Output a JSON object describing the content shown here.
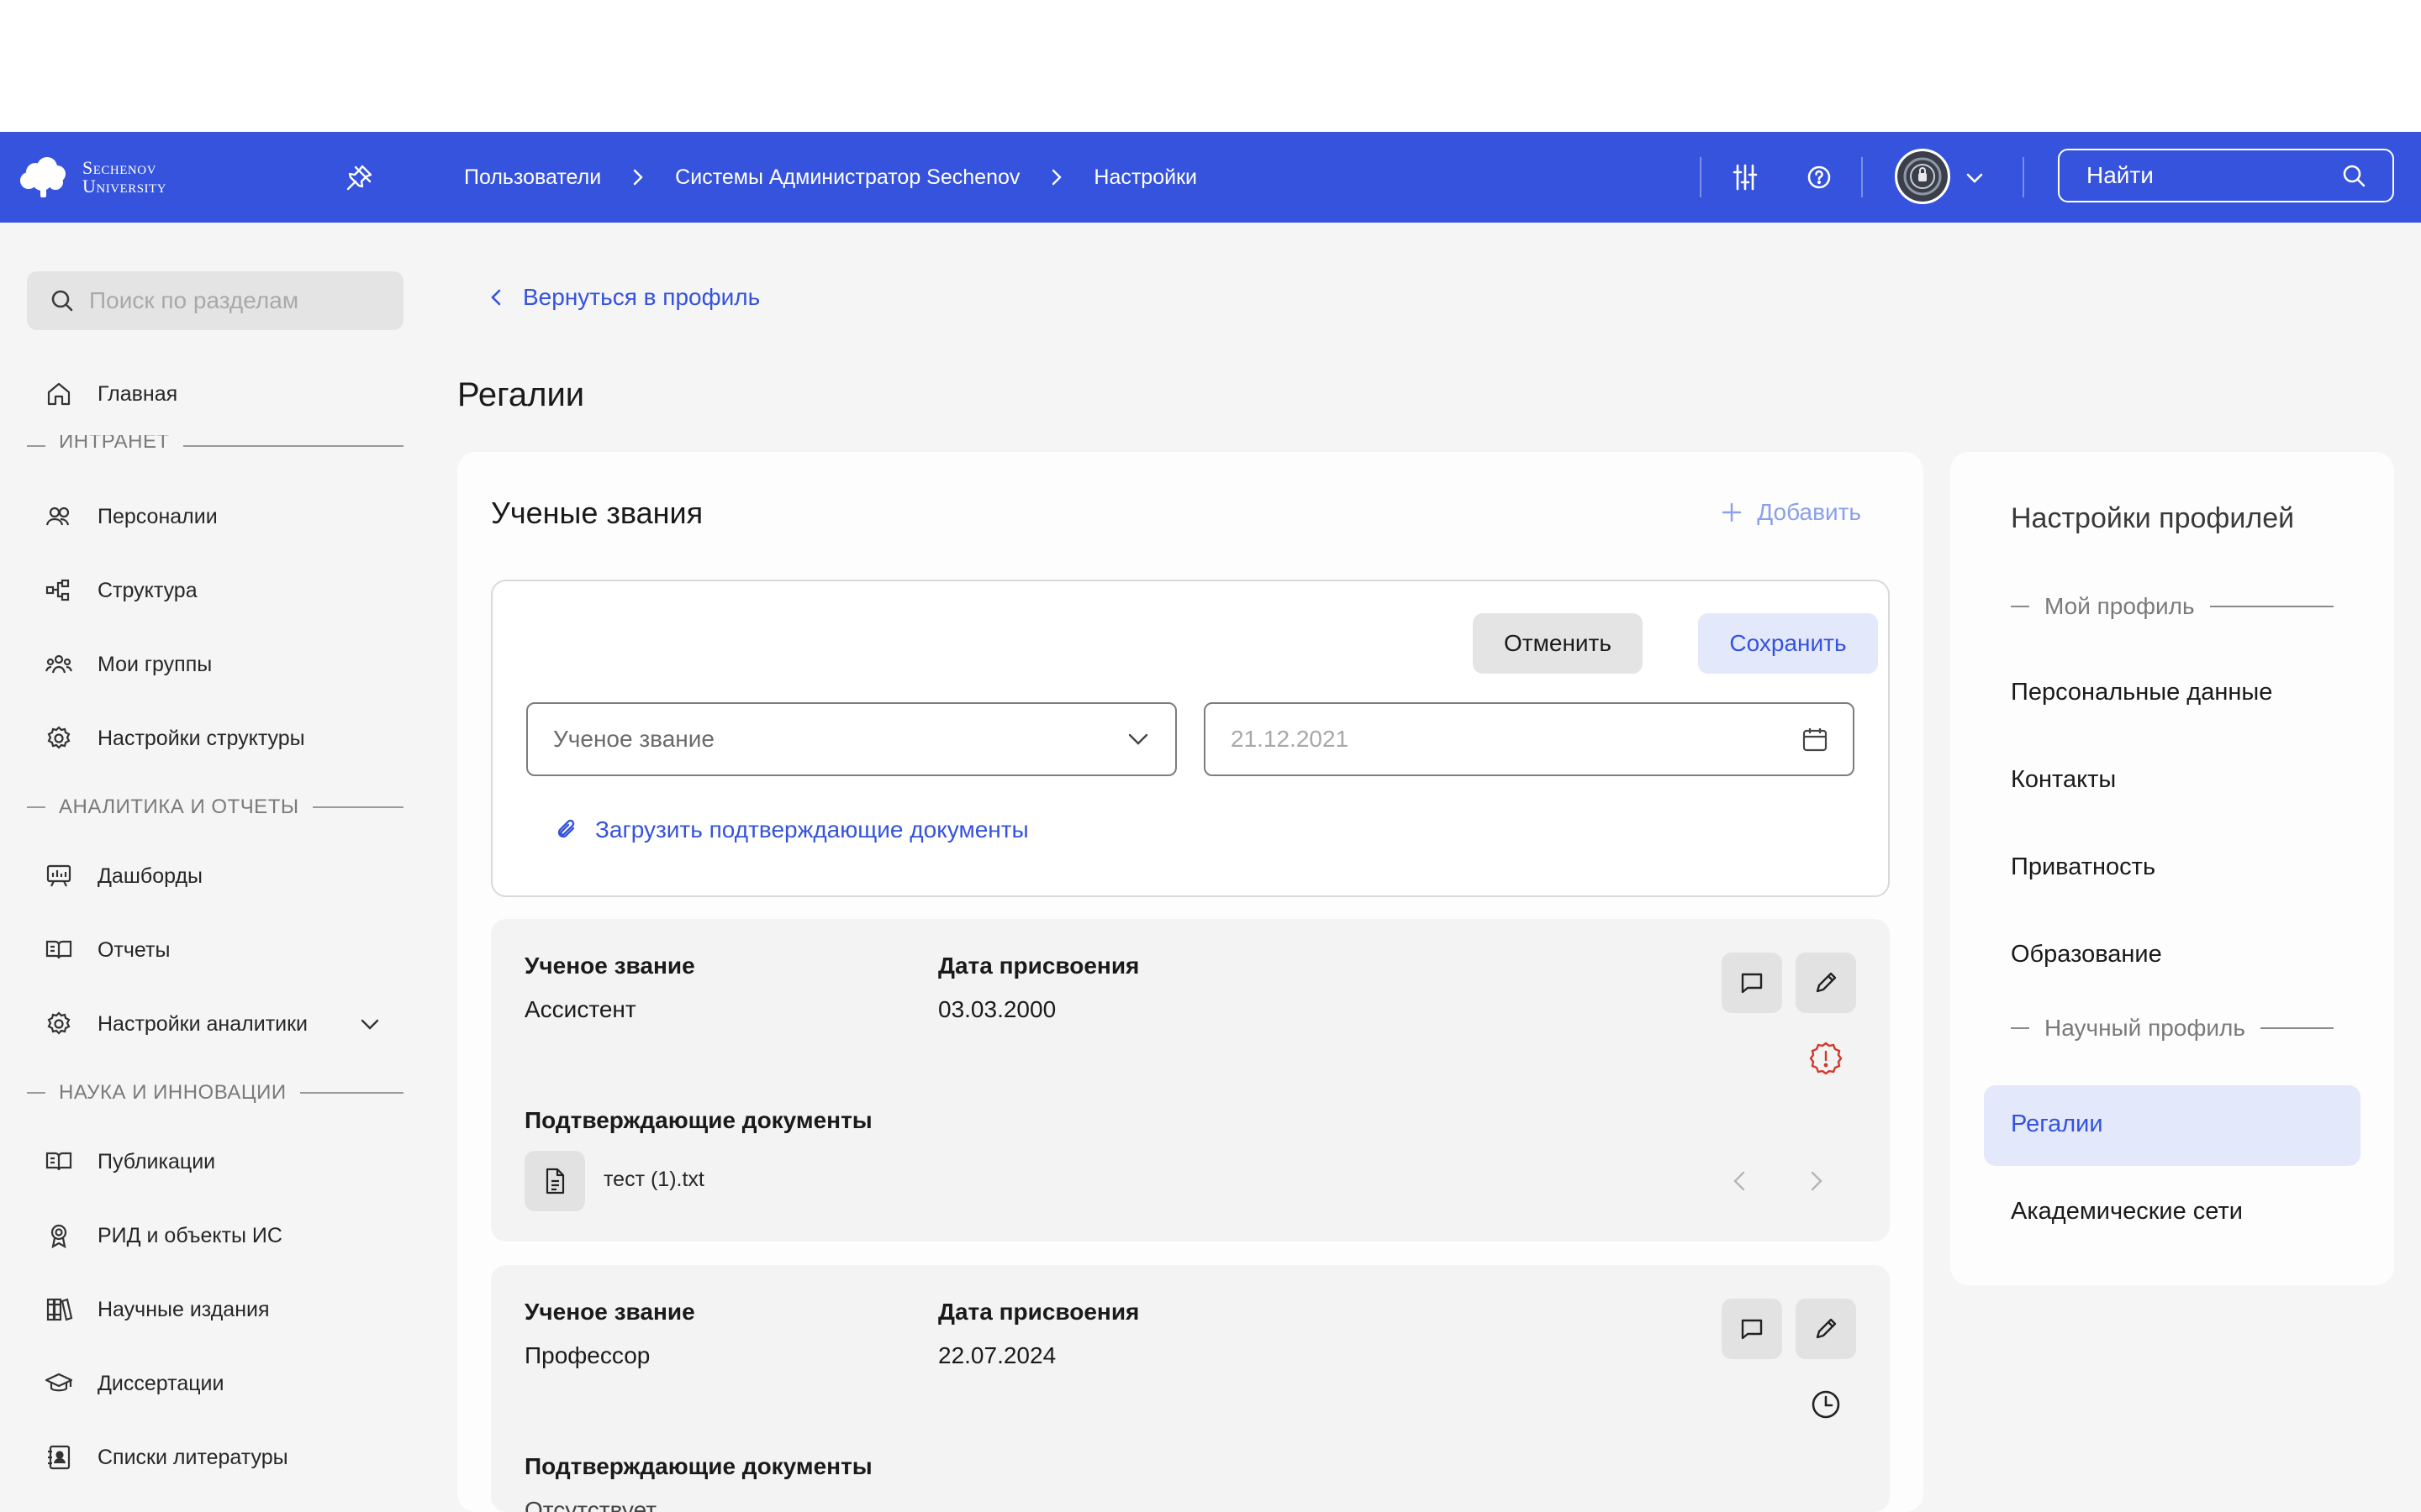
{
  "header": {
    "logo_line1": "Sechenov",
    "logo_line2": "University",
    "breadcrumbs": [
      "Пользователи",
      "Системы Администратор Sechenov",
      "Настройки"
    ],
    "search_placeholder": "Найти"
  },
  "sidebar": {
    "search_placeholder": "Поиск по разделам",
    "home": "Главная",
    "sections": [
      {
        "title": "ИНТРАНЕТ",
        "items": [
          "Персоналии",
          "Структура",
          "Мои группы",
          "Настройки структуры"
        ]
      },
      {
        "title": "АНАЛИТИКА И ОТЧЕТЫ",
        "items": [
          "Дашборды",
          "Отчеты",
          "Настройки аналитики"
        ]
      },
      {
        "title": "НАУКА И ИННОВАЦИИ",
        "items": [
          "Публикации",
          "РИД и объекты ИС",
          "Научные издания",
          "Диссертации",
          "Списки литературы"
        ]
      }
    ]
  },
  "main": {
    "back_label": "Вернуться в профиль",
    "page_title": "Регалии",
    "card_title": "Ученые звания",
    "add_label": "Добавить",
    "form": {
      "cancel_label": "Отменить",
      "save_label": "Сохранить",
      "title_placeholder": "Ученое звание",
      "date_placeholder": "21.12.2021",
      "upload_label": "Загрузить подтверждающие документы"
    },
    "entries": [
      {
        "title_label": "Ученое звание",
        "title_value": "Ассистент",
        "date_label": "Дата присвоения",
        "date_value": "03.03.2000",
        "docs_label": "Подтверждающие документы",
        "doc_name": "тест (1).txt",
        "status_icon": "alert-badge-icon",
        "status_color": "#d0392b"
      },
      {
        "title_label": "Ученое звание",
        "title_value": "Профессор",
        "date_label": "Дата присвоения",
        "date_value": "22.07.2024",
        "docs_label": "Подтверждающие документы",
        "docs_value": "Отсутствует",
        "status_icon": "clock-icon"
      }
    ]
  },
  "right_panel": {
    "title": "Настройки профилей",
    "section_my": "Мой профиль",
    "my_items": [
      "Персональные данные",
      "Контакты",
      "Приватность",
      "Образование"
    ],
    "section_science": "Научный профиль",
    "science_items": [
      "Регалии",
      "Академические сети"
    ],
    "active_item": "Регалии"
  },
  "colors": {
    "brand": "#3553dc",
    "active_bg": "#e3e8fb",
    "alert": "#d0392b"
  }
}
